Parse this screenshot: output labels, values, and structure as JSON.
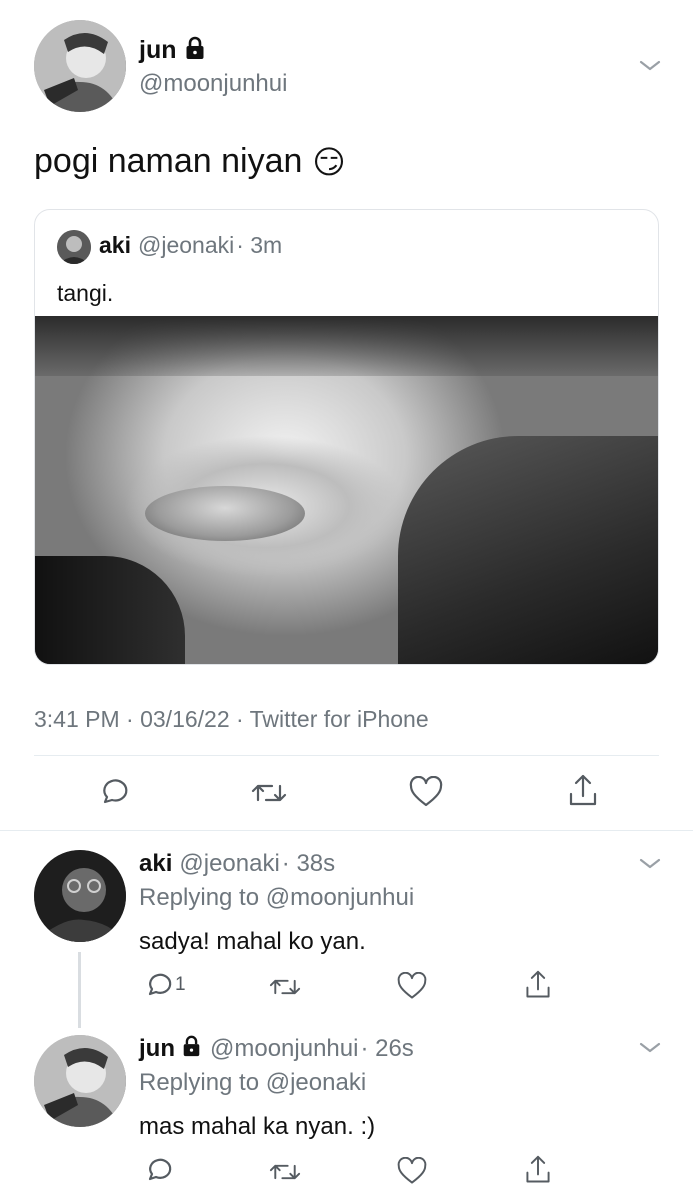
{
  "main_tweet": {
    "display_name": "jun",
    "handle": "@moonjunhui",
    "text": "pogi naman niyan",
    "emoji": "😏",
    "meta": "3:41 PM · 03/16/22 · Twitter for iPhone"
  },
  "quoted_tweet": {
    "display_name": "aki",
    "handle": "@jeonaki",
    "time": "· 3m",
    "text": "tangi."
  },
  "replies": [
    {
      "display_name": "aki",
      "handle": "@jeonaki",
      "time": "· 38s",
      "replying_to": "Replying to @moonjunhui",
      "text": "sadya! mahal ko yan.",
      "reply_count": "1"
    },
    {
      "display_name": "jun",
      "handle": "@moonjunhui",
      "time": "· 26s",
      "replying_to": "Replying to @jeonaki",
      "text": "mas mahal ka nyan. :)",
      "reply_count": ""
    }
  ],
  "icons": {
    "lock": "lock-icon",
    "reply": "reply-icon",
    "retweet": "retweet-icon",
    "like": "heart-icon",
    "share": "share-icon",
    "more": "chevron-down-icon"
  },
  "colors": {
    "text": "#0f1419",
    "secondary": "#6e767d",
    "divider": "#e6ecf0"
  }
}
